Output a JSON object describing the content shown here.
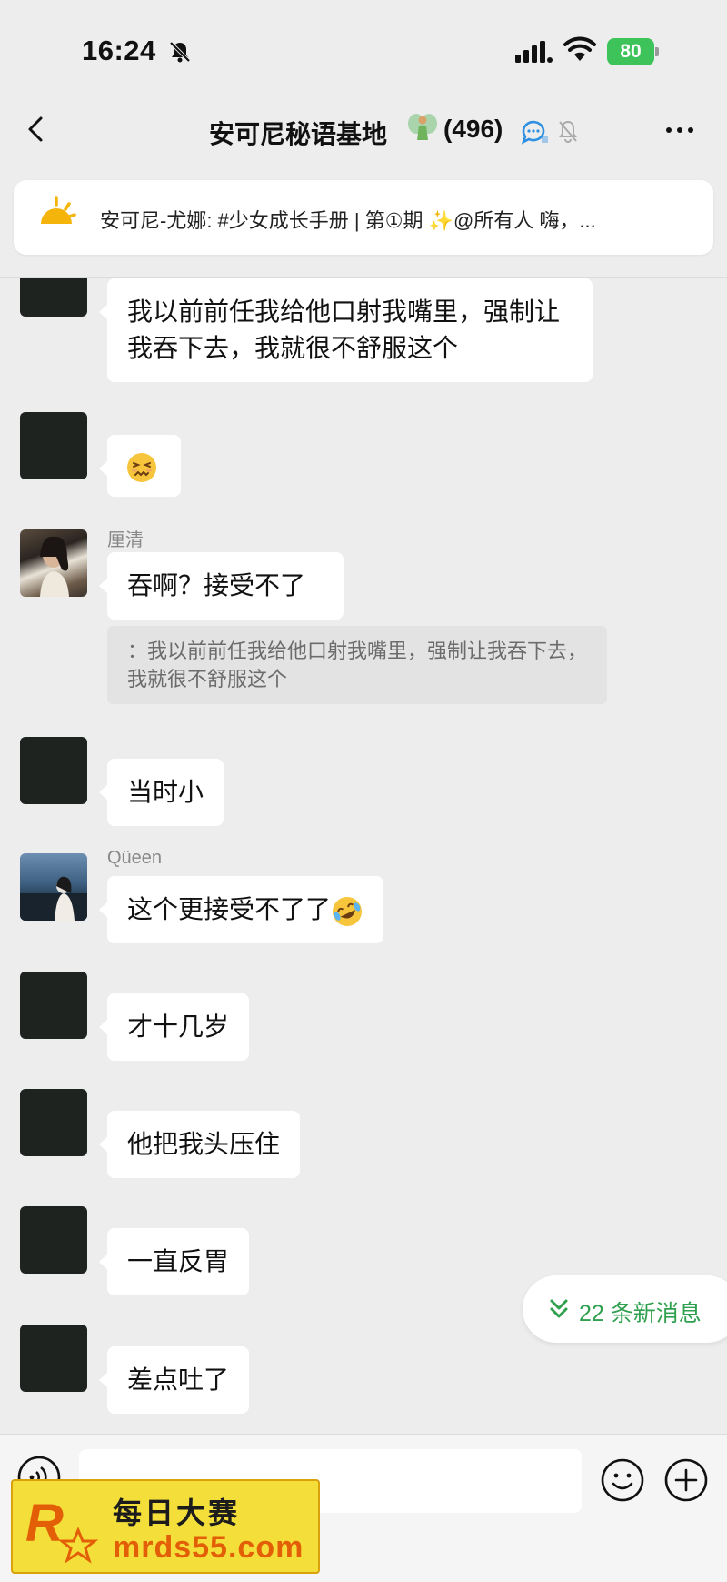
{
  "status_bar": {
    "time": "16:24",
    "battery": "80"
  },
  "header": {
    "title": "安可尼秘语基地",
    "member_count": "(496)"
  },
  "announcement": {
    "text": "安可尼-尤娜: #少女成长手册 | 第①期 ✨@所有人  嗨，..."
  },
  "messages": [
    {
      "sender": "",
      "text": "我以前前任我给他口射我嘴里，强制让我吞下去，我就很不舒服这个"
    },
    {
      "sender": "",
      "emoji": "persevering-face-emoji"
    },
    {
      "sender": "厘清",
      "text": "吞啊？接受不了",
      "quote": "：我以前前任我给他口射我嘴里，强制让我吞下去，我就很不舒服这个"
    },
    {
      "sender": "",
      "text": "当时小"
    },
    {
      "sender": "Qüeen",
      "text": "这个更接受不了了"
    },
    {
      "sender": "",
      "text": "才十几岁"
    },
    {
      "sender": "",
      "text": "他把我头压住"
    },
    {
      "sender": "",
      "text": "一直反胃"
    },
    {
      "sender": "",
      "text": "差点吐了"
    }
  ],
  "new_messages": {
    "label": "22 条新消息"
  },
  "input": {
    "placeholder": ""
  },
  "watermark": {
    "line1": "每日大赛",
    "line2": "mrds55.com"
  },
  "colors": {
    "background": "#ededed",
    "accent_green": "#2fa04e",
    "battery_green": "#3ec35a"
  }
}
